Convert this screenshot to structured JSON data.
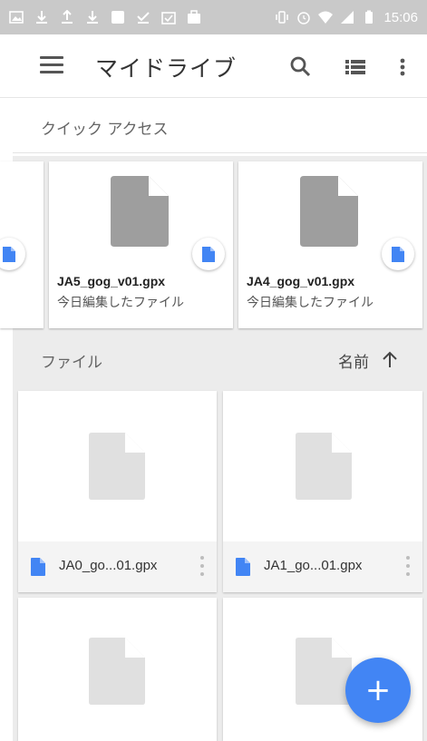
{
  "status_bar": {
    "time": "15:06",
    "icons": [
      "image-icon",
      "download-icon",
      "upload-icon",
      "download-icon",
      "square-icon",
      "check-download-icon",
      "checkbox-icon",
      "bag-icon",
      "vibrate-icon",
      "alarm-icon",
      "wifi-icon",
      "signal-icon",
      "battery-icon"
    ]
  },
  "app_bar": {
    "title": "マイドライブ",
    "icons": [
      "menu-icon",
      "search-icon",
      "list-view-icon",
      "more-vert-icon"
    ]
  },
  "quick_access": {
    "label": "クイック アクセス",
    "cards": [
      {
        "name": "JA5_gog_v01.gpx",
        "subtitle": "今日編集したファイル"
      },
      {
        "name": "JA4_gog_v01.gpx",
        "subtitle": "今日編集したファイル"
      }
    ]
  },
  "files": {
    "label": "ファイル",
    "sort_label": "名前",
    "items": [
      {
        "name": "JA0_go...01.gpx"
      },
      {
        "name": "JA1_go...01.gpx"
      },
      {
        "name": ""
      },
      {
        "name": ""
      }
    ]
  },
  "fab": {
    "label": "+"
  },
  "colors": {
    "accent": "#4285f4",
    "status_bar": "#c9c9c9",
    "section_bg": "#ececec"
  }
}
